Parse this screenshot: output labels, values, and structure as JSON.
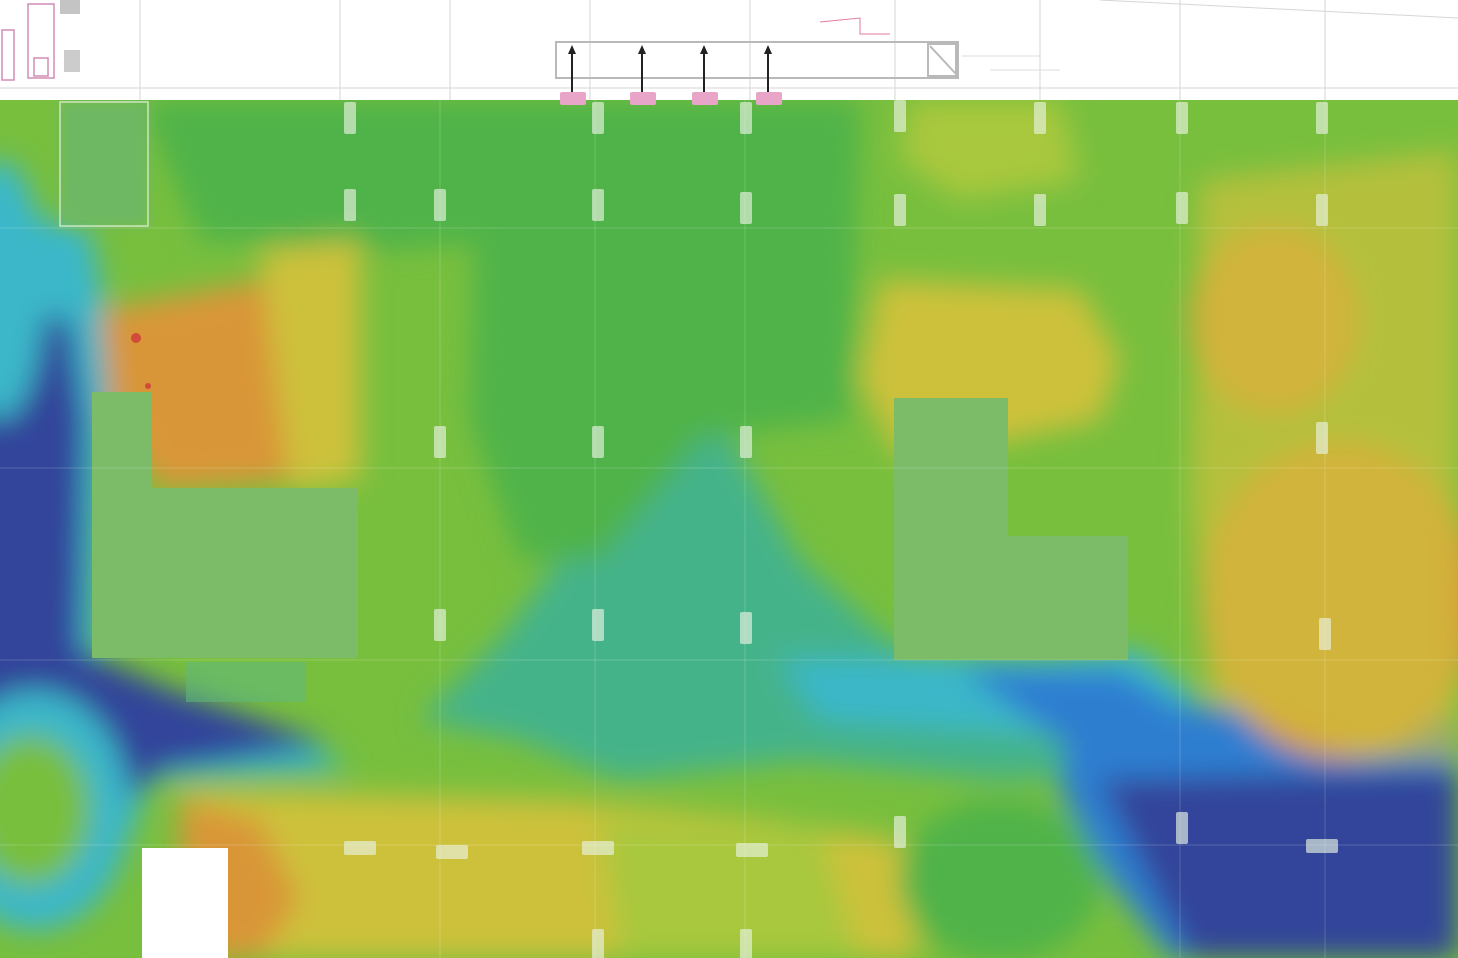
{
  "colors": {
    "deep_blue": "#33449a",
    "blue": "#2f7ed0",
    "cyan": "#3ab7c9",
    "teal": "#45b38a",
    "green": "#4fb34a",
    "light_green": "#78bf3e",
    "yellow_green": "#a9c83c",
    "yellow": "#cdc13a",
    "orange": "#d99639",
    "red_orange": "#d27a33",
    "red": "#d24a3a",
    "room_fill": "#7cbc68",
    "column_marker": "#e8f3e2",
    "antenna_pad": "#e8a5c8",
    "plan_line": "#c9c9c9"
  },
  "map": {
    "legend_caption": "",
    "access_point_count": 4
  }
}
